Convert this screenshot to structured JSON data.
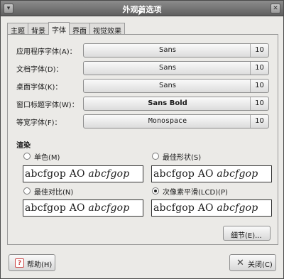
{
  "window": {
    "title": "外观首选项"
  },
  "tabs": [
    {
      "label": "主题"
    },
    {
      "label": "背景"
    },
    {
      "label": "字体"
    },
    {
      "label": "界面"
    },
    {
      "label": "视觉效果"
    }
  ],
  "fonts": [
    {
      "label": "应用程序字体(A)：",
      "font": "Sans",
      "size": "10"
    },
    {
      "label": "文档字体(D)：",
      "font": "Sans",
      "size": "10"
    },
    {
      "label": "桌面字体(K)：",
      "font": "Sans",
      "size": "10"
    },
    {
      "label": "窗口标题字体(W)：",
      "font": "Sans Bold",
      "size": "10"
    },
    {
      "label": "等宽字体(F)：",
      "font": "Monospace",
      "size": "10"
    }
  ],
  "rendering": {
    "title": "渲染",
    "sample_text": "abcfgop AO ",
    "sample_italic": "abcfgop",
    "options": [
      {
        "label": "单色(M)",
        "selected": false
      },
      {
        "label": "最佳形状(S)",
        "selected": false
      },
      {
        "label": "最佳对比(N)",
        "selected": false
      },
      {
        "label": "次像素平滑(LCD)(P)",
        "selected": true
      }
    ]
  },
  "buttons": {
    "details": "细节(E)...",
    "help": "帮助(H)",
    "close": "关闭(C)"
  }
}
